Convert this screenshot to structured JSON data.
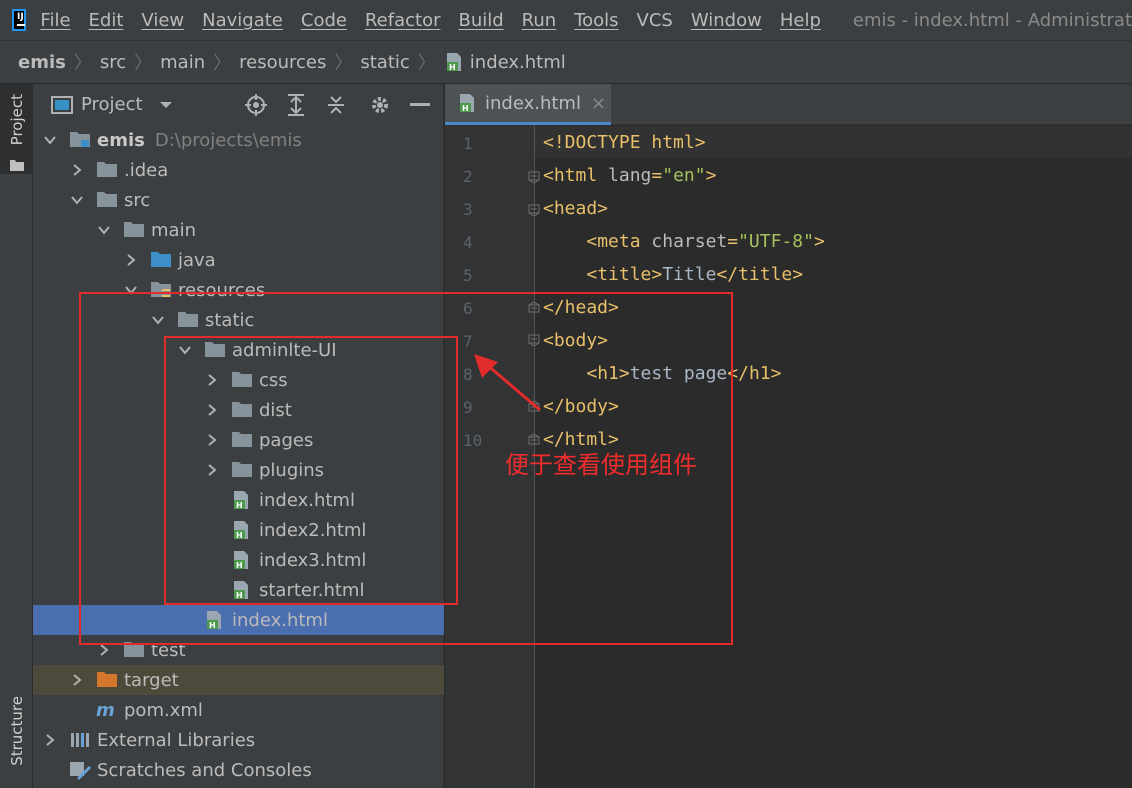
{
  "menu": {
    "items": [
      "File",
      "Edit",
      "View",
      "Navigate",
      "Code",
      "Refactor",
      "Build",
      "Run",
      "Tools",
      "VCS",
      "Window",
      "Help"
    ],
    "window_title": "emis - index.html - Administrat"
  },
  "breadcrumb": [
    "emis",
    "src",
    "main",
    "resources",
    "static",
    "index.html"
  ],
  "left_stripe": {
    "project": "Project",
    "structure": "Structure"
  },
  "project_panel": {
    "title": "Project",
    "tree": [
      {
        "label": "emis",
        "path": "D:\\projects\\emis",
        "type": "module",
        "expanded": true,
        "level": 0
      },
      {
        "label": ".idea",
        "type": "folder",
        "expanded": false,
        "level": 1
      },
      {
        "label": "src",
        "type": "folder",
        "expanded": true,
        "level": 1
      },
      {
        "label": "main",
        "type": "folder",
        "expanded": true,
        "level": 2
      },
      {
        "label": "java",
        "type": "folder-blue",
        "expanded": false,
        "level": 3
      },
      {
        "label": "resources",
        "type": "folder-res",
        "expanded": true,
        "level": 3
      },
      {
        "label": "static",
        "type": "folder",
        "expanded": true,
        "level": 4
      },
      {
        "label": "adminlte-UI",
        "type": "folder",
        "expanded": true,
        "level": 5
      },
      {
        "label": "css",
        "type": "folder",
        "expanded": false,
        "level": 6
      },
      {
        "label": "dist",
        "type": "folder",
        "expanded": false,
        "level": 6
      },
      {
        "label": "pages",
        "type": "folder",
        "expanded": false,
        "level": 6
      },
      {
        "label": "plugins",
        "type": "folder",
        "expanded": false,
        "level": 6
      },
      {
        "label": "index.html",
        "type": "html",
        "level": 6
      },
      {
        "label": "index2.html",
        "type": "html",
        "level": 6
      },
      {
        "label": "index3.html",
        "type": "html",
        "level": 6
      },
      {
        "label": "starter.html",
        "type": "html",
        "level": 6
      },
      {
        "label": "index.html",
        "type": "html",
        "level": 5,
        "selected": true
      },
      {
        "label": "test",
        "type": "folder",
        "expanded": false,
        "level": 2
      },
      {
        "label": "target",
        "type": "folder-orange",
        "expanded": false,
        "level": 1,
        "excluded": true
      },
      {
        "label": "pom.xml",
        "type": "maven",
        "level": 1
      },
      {
        "label": "External Libraries",
        "type": "libs",
        "expanded": false,
        "level": 0
      },
      {
        "label": "Scratches and Consoles",
        "type": "scratch",
        "level": 0
      }
    ]
  },
  "editor": {
    "tab_label": "index.html",
    "close_glyph": "×",
    "line_numbers": [
      "1",
      "2",
      "3",
      "4",
      "5",
      "6",
      "7",
      "8",
      "9",
      "10"
    ]
  },
  "annotation": {
    "text": "便于查看使用组件",
    "color": "#e22b2b"
  },
  "colors": {
    "selection": "#4b6eaf",
    "tag": "#e8bf6a",
    "string": "#a5c25c",
    "folder": "#87939a"
  }
}
